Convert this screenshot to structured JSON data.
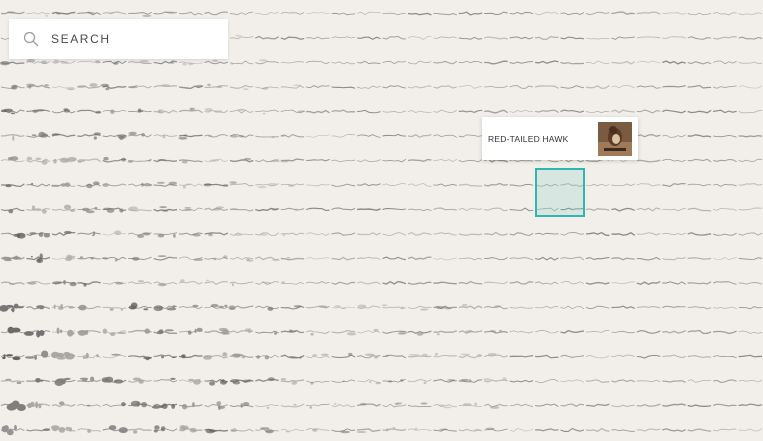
{
  "search": {
    "label": "SEARCH",
    "icon": "search-icon"
  },
  "tooltip": {
    "label": "RED-TAILED HAWK",
    "thumbnail_icon": "hawk-photo-thumbnail"
  },
  "colors": {
    "background": "#f2efea",
    "selection_border": "#2fb6b0",
    "selection_fill": "#cfe8e3",
    "spectrogram_ink": "#555555"
  }
}
